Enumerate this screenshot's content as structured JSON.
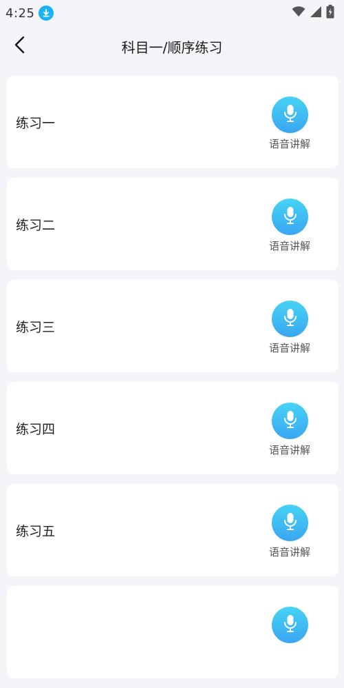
{
  "status": {
    "time": "4:25",
    "icons": [
      "download-icon",
      "wifi-icon",
      "signal-icon",
      "battery-icon"
    ]
  },
  "header": {
    "title": "科目一/顺序练习"
  },
  "practice_list": [
    {
      "label": "练习一",
      "voice_label": "语音讲解"
    },
    {
      "label": "练习二",
      "voice_label": "语音讲解"
    },
    {
      "label": "练习三",
      "voice_label": "语音讲解"
    },
    {
      "label": "练习四",
      "voice_label": "语音讲解"
    },
    {
      "label": "练习五",
      "voice_label": "语音讲解"
    }
  ],
  "colors": {
    "background": "#f4f4f9",
    "card": "#ffffff",
    "mic_gradient_top": "#46d3f3",
    "mic_gradient_bottom": "#3aa6f3"
  }
}
